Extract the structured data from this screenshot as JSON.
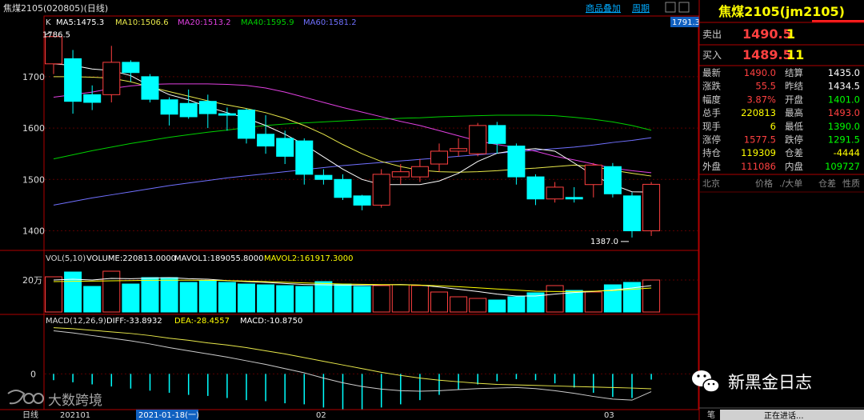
{
  "header": {
    "symbol_title": "焦煤2105(020805)(日线)",
    "overlay_button": "商品叠加",
    "period_button": "周期",
    "price_flag": "1791.3"
  },
  "colors": {
    "up": "#ff4040",
    "down": "#00ffff",
    "ma5": "#ffffff",
    "ma10": "#e8e84a",
    "ma20": "#e040e0",
    "ma40": "#00d000",
    "ma60": "#7070ff",
    "grid": "#800000",
    "axis": "#b00000",
    "yellow": "#ffff00"
  },
  "chart_data": [
    {
      "type": "candlestick",
      "legend": {
        "label": "K",
        "entries": [
          {
            "text": "MA5:1475.3",
            "color": "#ffffff"
          },
          {
            "text": "MA10:1506.6",
            "color": "#e8e84a"
          },
          {
            "text": "MA20:1513.2",
            "color": "#e040e0"
          },
          {
            "text": "MA40:1595.9",
            "color": "#00d000"
          },
          {
            "text": "MA60:1581.2",
            "color": "#7070ff"
          }
        ]
      },
      "y_ticks": [
        1400,
        1500,
        1600,
        1700
      ],
      "ylim": [
        1365,
        1815
      ],
      "annotations": {
        "high_label": "1786.5",
        "low_label": "1387.0"
      },
      "candles": [
        {
          "o": 1725,
          "h": 1786.5,
          "l": 1705,
          "c": 1778
        },
        {
          "o": 1735,
          "h": 1752,
          "l": 1628,
          "c": 1652
        },
        {
          "o": 1665,
          "h": 1683,
          "l": 1635,
          "c": 1650
        },
        {
          "o": 1665,
          "h": 1760,
          "l": 1650,
          "c": 1728
        },
        {
          "o": 1728,
          "h": 1732,
          "l": 1690,
          "c": 1708
        },
        {
          "o": 1700,
          "h": 1705,
          "l": 1650,
          "c": 1656
        },
        {
          "o": 1655,
          "h": 1660,
          "l": 1605,
          "c": 1627
        },
        {
          "o": 1648,
          "h": 1675,
          "l": 1618,
          "c": 1622
        },
        {
          "o": 1652,
          "h": 1665,
          "l": 1600,
          "c": 1628
        },
        {
          "o": 1628,
          "h": 1640,
          "l": 1595,
          "c": 1625
        },
        {
          "o": 1635,
          "h": 1638,
          "l": 1570,
          "c": 1580
        },
        {
          "o": 1588,
          "h": 1625,
          "l": 1550,
          "c": 1565
        },
        {
          "o": 1580,
          "h": 1595,
          "l": 1530,
          "c": 1545
        },
        {
          "o": 1575,
          "h": 1580,
          "l": 1490,
          "c": 1510
        },
        {
          "o": 1508,
          "h": 1520,
          "l": 1490,
          "c": 1500
        },
        {
          "o": 1500,
          "h": 1510,
          "l": 1460,
          "c": 1465
        },
        {
          "o": 1468,
          "h": 1470,
          "l": 1440,
          "c": 1450
        },
        {
          "o": 1450,
          "h": 1520,
          "l": 1445,
          "c": 1510
        },
        {
          "o": 1505,
          "h": 1530,
          "l": 1490,
          "c": 1515
        },
        {
          "o": 1505,
          "h": 1540,
          "l": 1495,
          "c": 1525
        },
        {
          "o": 1530,
          "h": 1570,
          "l": 1515,
          "c": 1555
        },
        {
          "o": 1555,
          "h": 1580,
          "l": 1545,
          "c": 1560
        },
        {
          "o": 1550,
          "h": 1610,
          "l": 1545,
          "c": 1605
        },
        {
          "o": 1605,
          "h": 1612,
          "l": 1550,
          "c": 1570
        },
        {
          "o": 1565,
          "h": 1570,
          "l": 1490,
          "c": 1505
        },
        {
          "o": 1505,
          "h": 1510,
          "l": 1450,
          "c": 1462
        },
        {
          "o": 1462,
          "h": 1495,
          "l": 1455,
          "c": 1485
        },
        {
          "o": 1465,
          "h": 1485,
          "l": 1455,
          "c": 1462
        },
        {
          "o": 1490,
          "h": 1532,
          "l": 1465,
          "c": 1528
        },
        {
          "o": 1525,
          "h": 1532,
          "l": 1465,
          "c": 1472
        },
        {
          "o": 1468,
          "h": 1475,
          "l": 1387,
          "c": 1400
        },
        {
          "o": 1400,
          "h": 1495,
          "l": 1390,
          "c": 1490.5
        }
      ],
      "ma5": [
        1725,
        1722,
        1715,
        1712,
        1702,
        1682,
        1665,
        1655,
        1641,
        1630,
        1619,
        1605,
        1588,
        1568,
        1544,
        1520,
        1500,
        1490,
        1490,
        1490,
        1497,
        1512,
        1535,
        1551,
        1557,
        1560,
        1555,
        1532,
        1508,
        1490,
        1476,
        1475.3
      ],
      "ma10": [
        1700,
        1700,
        1699,
        1697,
        1690,
        1680,
        1671,
        1662,
        1653,
        1645,
        1638,
        1630,
        1619,
        1605,
        1588,
        1568,
        1550,
        1535,
        1525,
        1518,
        1515,
        1514,
        1515,
        1517,
        1520,
        1522,
        1525,
        1528,
        1525,
        1518,
        1512,
        1506.6
      ],
      "ma20": [
        1660,
        1665,
        1670,
        1677,
        1682,
        1685,
        1686,
        1686,
        1686,
        1685,
        1683,
        1678,
        1670,
        1660,
        1650,
        1640,
        1631,
        1622,
        1613,
        1605,
        1595,
        1585,
        1575,
        1568,
        1562,
        1555,
        1545,
        1538,
        1530,
        1522,
        1517,
        1513.2
      ],
      "ma40": [
        1540,
        1548,
        1556,
        1563,
        1570,
        1576,
        1582,
        1587,
        1592,
        1596,
        1601,
        1605,
        1608,
        1610,
        1612,
        1614,
        1616,
        1617,
        1619,
        1620,
        1622,
        1623,
        1624,
        1625,
        1625,
        1625,
        1624,
        1621,
        1617,
        1612,
        1605,
        1595.9
      ],
      "ma60": [
        1450,
        1457,
        1464,
        1470,
        1476,
        1482,
        1488,
        1493,
        1498,
        1503,
        1507,
        1511,
        1515,
        1519,
        1523,
        1527,
        1530,
        1533,
        1536,
        1539,
        1542,
        1545,
        1548,
        1551,
        1554,
        1557,
        1560,
        1563,
        1567,
        1572,
        1576,
        1581.2
      ]
    },
    {
      "type": "bar",
      "title": "VOL(5,10)",
      "legend": [
        {
          "text": "VOLUME:220813.0000",
          "color": "#ffffff"
        },
        {
          "text": "MAVOL1:189055.8000",
          "color": "#ffffff"
        },
        {
          "text": "MAVOL2:161917.3000",
          "color": "#ffff00"
        }
      ],
      "y_tick_label": "20万",
      "y_tick_value": 200000,
      "ylim": [
        0,
        300000
      ],
      "values": [
        220000,
        250000,
        160000,
        255000,
        175000,
        215000,
        215000,
        185000,
        195000,
        185000,
        175000,
        170000,
        165000,
        160000,
        190000,
        175000,
        160000,
        165000,
        170000,
        165000,
        125000,
        95000,
        85000,
        75000,
        95000,
        120000,
        165000,
        135000,
        125000,
        170000,
        185000,
        200000,
        220813
      ],
      "mavol1": [
        200000,
        205000,
        200000,
        210000,
        208000,
        211000,
        215000,
        208000,
        205000,
        196000,
        190000,
        185000,
        178000,
        172000,
        170000,
        168000,
        168000,
        170000,
        172000,
        168000,
        156000,
        142000,
        128000,
        112000,
        100000,
        100000,
        112000,
        122000,
        128000,
        138000,
        150000,
        165000,
        189055.8
      ],
      "mavol2": [
        190000,
        192000,
        193000,
        195000,
        196000,
        198000,
        199000,
        199000,
        198000,
        196000,
        193000,
        190000,
        186000,
        182000,
        178000,
        175000,
        173000,
        171000,
        170000,
        168000,
        164000,
        158000,
        151000,
        144000,
        137000,
        130000,
        128000,
        128000,
        130000,
        134000,
        142000,
        150000,
        161917.3
      ]
    },
    {
      "type": "line",
      "title": "MACD(12,26,9)",
      "legend": [
        {
          "text": "DIFF:-33.8932",
          "color": "#ffffff"
        },
        {
          "text": "DEA:-28.4557",
          "color": "#ffff00"
        },
        {
          "text": "MACD:-10.8750",
          "color": "#ffffff"
        }
      ],
      "zero_label": "0",
      "ylim": [
        -65,
        95
      ],
      "diff": [
        82,
        78,
        73,
        68,
        63,
        57,
        50,
        44,
        38,
        32,
        25,
        18,
        10,
        2,
        -8,
        -17,
        -24,
        -29,
        -32,
        -33,
        -32,
        -30,
        -28,
        -27,
        -26,
        -28,
        -32,
        -37,
        -43,
        -48,
        -50,
        -33.9
      ],
      "dea": [
        88,
        86,
        83,
        80,
        77,
        73,
        68,
        64,
        59,
        55,
        50,
        44,
        38,
        31,
        24,
        17,
        10,
        3,
        -3,
        -8,
        -12,
        -15,
        -18,
        -20,
        -21,
        -22,
        -23,
        -24,
        -25,
        -26,
        -27,
        -28.5
      ],
      "macd": [
        -12,
        -16,
        -20,
        -24,
        -28,
        -32,
        -36,
        -40,
        -42,
        -46,
        -50,
        -52,
        -56,
        -58,
        -64,
        -68,
        -68,
        -64,
        -58,
        -50,
        -40,
        -30,
        -20,
        -14,
        -10,
        -12,
        -18,
        -26,
        -36,
        -44,
        -46,
        -10.9
      ]
    }
  ],
  "x_axis": {
    "period_label": "日线",
    "date_ticks": [
      "202101",
      "02",
      "03"
    ],
    "cursor_date": "2021-01-18(一)"
  },
  "sidebar": {
    "title": "焦煤2105(jm2105)",
    "sell_label": "卖出",
    "sell_price": "1490.5",
    "sell_qty": "1",
    "buy_label": "买入",
    "buy_price": "1489.5",
    "buy_qty": "11",
    "rows": [
      {
        "l1": "最新",
        "v1": "1490.0",
        "c1": "#ff4040",
        "l2": "结算",
        "v2": "1435.0",
        "c2": "#ffffff"
      },
      {
        "l1": "涨跌",
        "v1": "55.5",
        "c1": "#ff4040",
        "l2": "昨结",
        "v2": "1434.5",
        "c2": "#ffffff"
      },
      {
        "l1": "幅度",
        "v1": "3.87%",
        "c1": "#ff4040",
        "l2": "开盘",
        "v2": "1401.0",
        "c2": "#00ff00"
      },
      {
        "l1": "总手",
        "v1": "220813",
        "c1": "#ffff00",
        "l2": "最高",
        "v2": "1493.0",
        "c2": "#ff4040"
      },
      {
        "l1": "现手",
        "v1": "6",
        "c1": "#ffff00",
        "l2": "最低",
        "v2": "1390.0",
        "c2": "#00ff00"
      },
      {
        "l1": "涨停",
        "v1": "1577.5",
        "c1": "#ff4040",
        "l2": "跌停",
        "v2": "1291.5",
        "c2": "#00ff00"
      },
      {
        "l1": "持仓",
        "v1": "119309",
        "c1": "#ffff00",
        "l2": "仓差",
        "v2": "-4444",
        "c2": "#ffff00"
      },
      {
        "l1": "外盘",
        "v1": "111086",
        "c1": "#ff4040",
        "l2": "内盘",
        "v2": "109727",
        "c2": "#00ff00"
      }
    ],
    "tab_region": "北京",
    "tab_price": "价格",
    "tab_volume": "./大单",
    "tab_oi": "仓差",
    "tab_nature": "性质",
    "pen_label": "笔",
    "status_text": "正在进话..."
  },
  "watermarks": {
    "wechat_text": "新黑金日志",
    "brand_text": "大数跨境"
  }
}
